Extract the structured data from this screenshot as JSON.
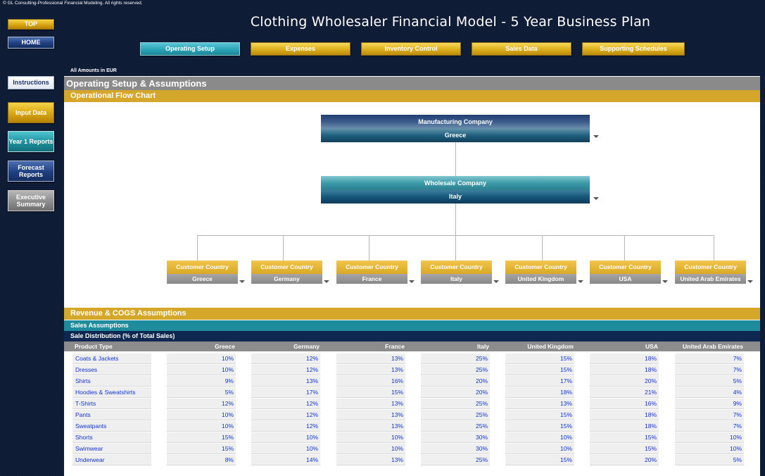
{
  "header": {
    "copyright": "© GL Consulting-Professional Financial Modeling. All rights reserved.",
    "title": "Clothing Wholesaler Financial Model - 5 Year Business Plan"
  },
  "left_nav": {
    "top": "TOP",
    "home": "HOME",
    "instructions": "Instructions",
    "input_data": "Input Data",
    "year1_reports": "Year 1 Reports",
    "forecast_reports": "Forecast Reports",
    "executive_summary": "Executive Summary"
  },
  "top_tabs": {
    "operating_setup": "Operating Setup",
    "expenses": "Expenses",
    "inventory_control": "Inventory Control",
    "sales_data": "Sales Data",
    "supporting_schedules": "Supporting Schedules"
  },
  "amounts_label": "All Amounts in  EUR",
  "sections": {
    "operating_setup": "Operating Setup & Assumptions",
    "flow_chart": "Operational Flow Chart",
    "revenue_cogs": "Revenue & COGS Assumptions",
    "sales_assumptions": "Sales Assumptions",
    "sale_distribution": "Sale Distribution (% of Total Sales)"
  },
  "flow_chart": {
    "manufacturing_label": "Manufacturing Company",
    "manufacturing_country": "Greece",
    "wholesale_label": "Wholesale Company",
    "wholesale_country": "Italy",
    "customer_label": "Customer Country",
    "customer_countries": [
      "Greece",
      "Germany",
      "France",
      "Italy",
      "United Kingdom",
      "USA",
      "United Arab Emirates"
    ]
  },
  "table": {
    "product_type_header": "Product Type",
    "countries": [
      "Greece",
      "Germany",
      "France",
      "Italy",
      "United Kingdom",
      "USA",
      "United Arab Emirates"
    ],
    "rows": [
      {
        "product": "Coats & Jackets",
        "values": [
          "10%",
          "12%",
          "13%",
          "25%",
          "15%",
          "18%",
          "7%"
        ]
      },
      {
        "product": "Dresses",
        "values": [
          "10%",
          "12%",
          "13%",
          "25%",
          "15%",
          "18%",
          "7%"
        ]
      },
      {
        "product": "Shirts",
        "values": [
          "9%",
          "13%",
          "16%",
          "20%",
          "17%",
          "20%",
          "5%"
        ]
      },
      {
        "product": "Hoodies & Sweatshirts",
        "values": [
          "5%",
          "17%",
          "15%",
          "20%",
          "18%",
          "21%",
          "4%"
        ]
      },
      {
        "product": "T-Shirts",
        "values": [
          "12%",
          "12%",
          "13%",
          "25%",
          "13%",
          "16%",
          "9%"
        ]
      },
      {
        "product": "Pants",
        "values": [
          "10%",
          "12%",
          "13%",
          "25%",
          "15%",
          "18%",
          "7%"
        ]
      },
      {
        "product": "Sweatpants",
        "values": [
          "10%",
          "12%",
          "13%",
          "25%",
          "15%",
          "18%",
          "7%"
        ]
      },
      {
        "product": "Shorts",
        "values": [
          "15%",
          "10%",
          "10%",
          "30%",
          "10%",
          "15%",
          "10%"
        ]
      },
      {
        "product": "Swimwear",
        "values": [
          "15%",
          "10%",
          "10%",
          "30%",
          "10%",
          "15%",
          "10%"
        ]
      },
      {
        "product": "Underwear",
        "values": [
          "8%",
          "14%",
          "13%",
          "25%",
          "15%",
          "20%",
          "5%"
        ]
      }
    ]
  }
}
